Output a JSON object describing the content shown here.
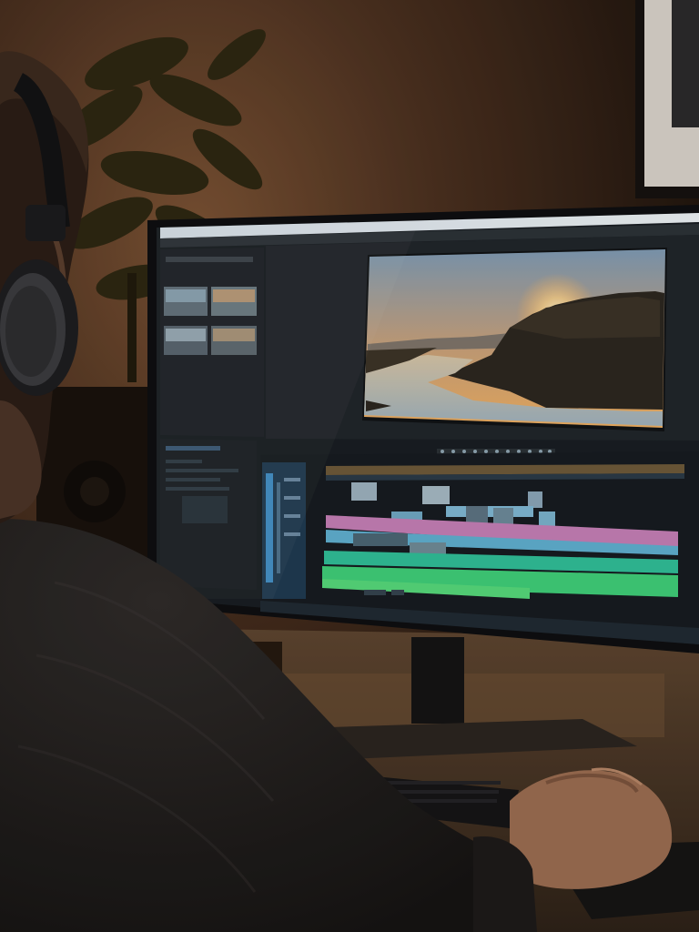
{
  "scene": {
    "subject": "person-with-headphones-editing-video",
    "palette": {
      "wall_warm": "#5a3a22",
      "wall_dark": "#1e140d",
      "plant": "#2f2a14",
      "monitor_bezel": "#0d0f12",
      "app_panel": "#1d2329",
      "app_panel_dark": "#14191e",
      "ui_accent_blue": "#3f8fc8",
      "clip_pink": "#c57fb8",
      "clip_cyan": "#66b7d4",
      "clip_green": "#3ecf7a",
      "sunset_sky_top": "#8aa6bd",
      "sunset_sky_bottom": "#e0a766",
      "sun": "#ffe2a0",
      "water": "#b9c7cf",
      "sweater": "#242121",
      "skin": "#a8765a",
      "desk": "#4d3a28"
    },
    "editor": {
      "panels": [
        "project-bin",
        "program-monitor",
        "timeline"
      ],
      "timeline_tracks": 3
    }
  }
}
